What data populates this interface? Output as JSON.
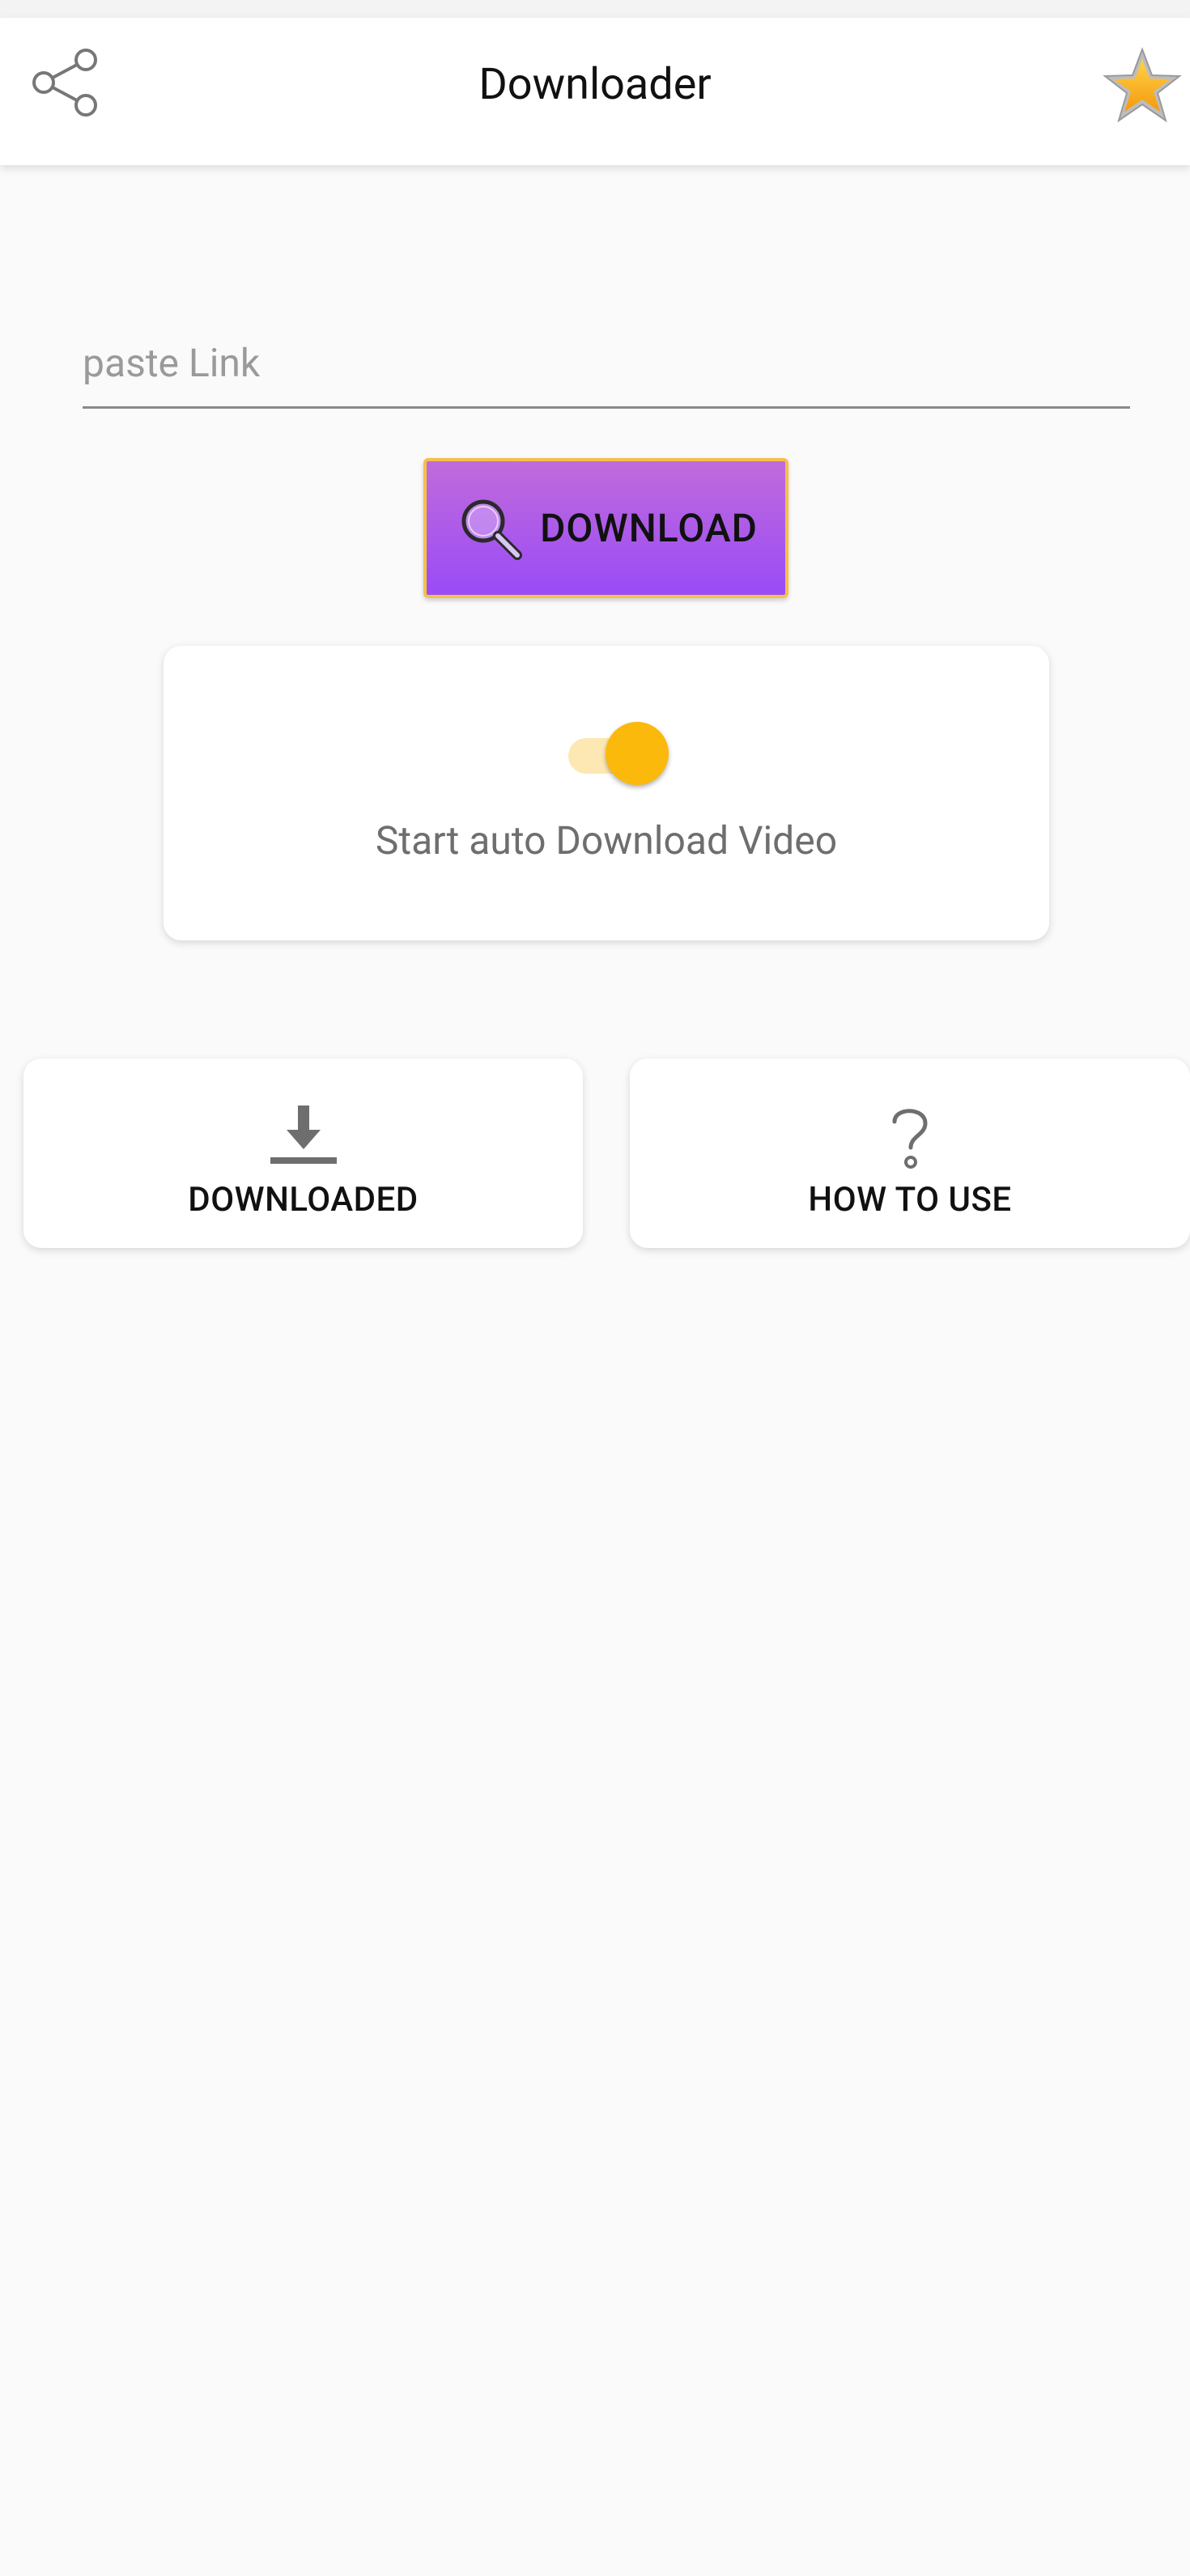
{
  "app_bar": {
    "title": "Downloader"
  },
  "link_input": {
    "placeholder": "paste Link",
    "value": ""
  },
  "download_button": {
    "label": "DOWNLOAD"
  },
  "auto_download": {
    "label": "Start auto Download Video",
    "enabled": true
  },
  "actions": {
    "downloaded_label": "DOWNLOADED",
    "how_to_use_label": "HOW TO USE"
  },
  "colors": {
    "accent_purple": "#9a4bf6",
    "toggle_yellow": "#fbb90b",
    "button_border": "#f5c04a"
  }
}
